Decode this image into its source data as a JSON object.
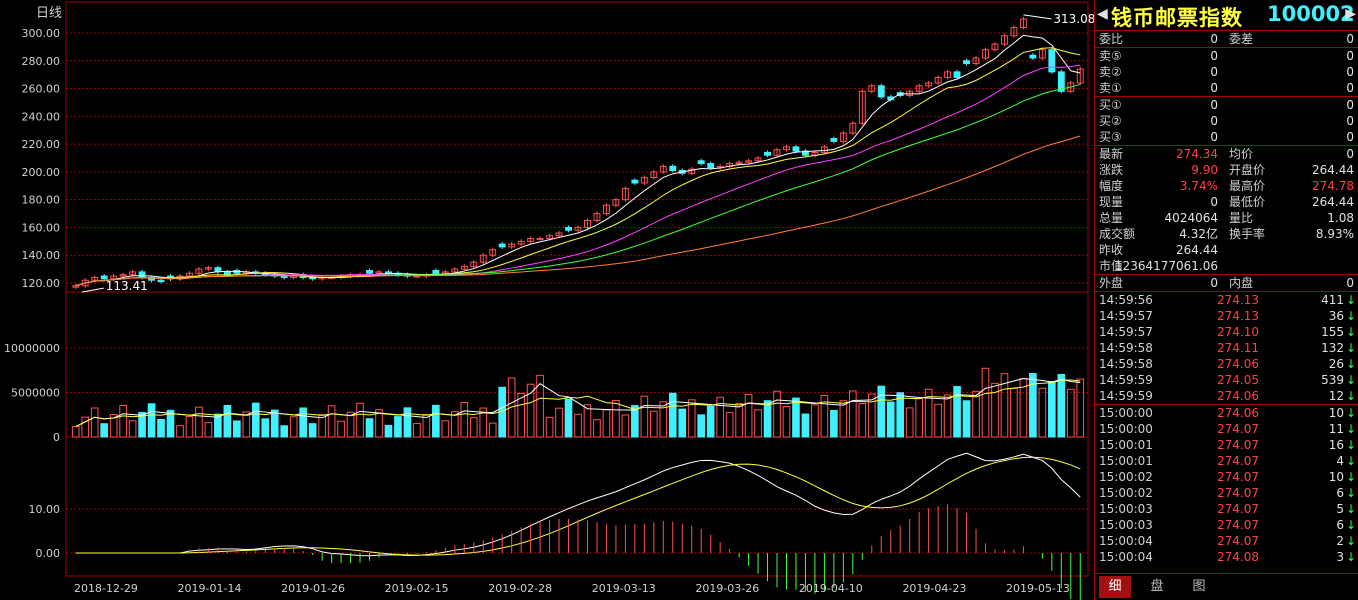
{
  "chart": {
    "period_label": "日线",
    "price_axis": [
      "300.00",
      "280.00",
      "260.00",
      "240.00",
      "220.00",
      "200.00",
      "180.00",
      "160.00",
      "140.00",
      "120.00"
    ],
    "volume_axis": [
      "10000000",
      "5000000",
      "0"
    ],
    "macd_axis": [
      "10.00",
      "0.00"
    ],
    "dates": [
      "2018-12-29",
      "2019-01-14",
      "2019-01-26",
      "2019-02-15",
      "2019-02-28",
      "2019-03-13",
      "2019-03-26",
      "2019-04-10",
      "2019-04-23",
      "2019-05-13"
    ],
    "high_marker": "313.08",
    "low_marker": "113.41",
    "colors": {
      "up": "#ff5050",
      "down": "#40f0ff",
      "grid": "#a00000",
      "ma5": "#ffffff",
      "ma10": "#ffff40",
      "ma20": "#ff40ff",
      "ma30": "#40ff40",
      "ma60": "#ff8030"
    }
  },
  "chart_data": {
    "type": "candlestick",
    "x": [
      "2018-12-29",
      "2019-01-14",
      "2019-01-26",
      "2019-02-15",
      "2019-02-28",
      "2019-03-13",
      "2019-03-26",
      "2019-04-10",
      "2019-04-23",
      "2019-05-13"
    ],
    "close_series": [
      118,
      122,
      124,
      123,
      125,
      126,
      128,
      124,
      122,
      121,
      123,
      125,
      127,
      130,
      131,
      128,
      126,
      127,
      128,
      127,
      126,
      125,
      124,
      125,
      124,
      123,
      124,
      124,
      125,
      126,
      126,
      127,
      128,
      127,
      126,
      125,
      125,
      126,
      127,
      128,
      130,
      132,
      135,
      140,
      144,
      146,
      148,
      150,
      152,
      152,
      154,
      156,
      158,
      160,
      165,
      170,
      176,
      180,
      188,
      192,
      196,
      200,
      204,
      201,
      199,
      202,
      206,
      203,
      204,
      206,
      207,
      208,
      210,
      212,
      216,
      218,
      215,
      212,
      214,
      218,
      222,
      228,
      235,
      258,
      262,
      254,
      252,
      255,
      258,
      262,
      264,
      268,
      272,
      268,
      278,
      282,
      288,
      292,
      298,
      304,
      310,
      282,
      288,
      272,
      258,
      264,
      274
    ],
    "high": 313.08,
    "low": 113.41,
    "ylim": [
      110,
      315
    ]
  },
  "quote": {
    "name": "钱币邮票指数",
    "code": "100002",
    "rows_top": [
      {
        "l": "委比",
        "v": "0",
        "l2": "委差",
        "v2": "0"
      }
    ],
    "asks": [
      {
        "l": "卖⑤",
        "v": "0",
        "v2": "0"
      },
      {
        "l": "卖②",
        "v": "0",
        "v2": "0"
      },
      {
        "l": "卖①",
        "v": "0",
        "v2": "0"
      }
    ],
    "bids": [
      {
        "l": "买①",
        "v": "0",
        "v2": "0"
      },
      {
        "l": "买②",
        "v": "0",
        "v2": "0"
      },
      {
        "l": "买③",
        "v": "0",
        "v2": "0"
      }
    ],
    "stats": [
      {
        "l": "最新",
        "v": "274.34",
        "vc": "r",
        "l2": "均价",
        "v2": "0",
        "v2c": "w"
      },
      {
        "l": "涨跌",
        "v": "9.90",
        "vc": "r",
        "l2": "开盘价",
        "v2": "264.44",
        "v2c": "w"
      },
      {
        "l": "幅度",
        "v": "3.74%",
        "vc": "r",
        "l2": "最高价",
        "v2": "274.78",
        "v2c": "r"
      },
      {
        "l": "现量",
        "v": "0",
        "vc": "w",
        "l2": "最低价",
        "v2": "264.44",
        "v2c": "w"
      },
      {
        "l": "总量",
        "v": "4024064",
        "vc": "w",
        "l2": "量比",
        "v2": "1.08",
        "v2c": "w"
      },
      {
        "l": "成交额",
        "v": "4.32亿",
        "vc": "w",
        "l2": "换手率",
        "v2": "8.93%",
        "v2c": "w"
      },
      {
        "l": "昨收",
        "v": "264.44",
        "vc": "w",
        "l2": "",
        "v2": "",
        "v2c": "w"
      },
      {
        "l": "市值",
        "v": "12364177061.06",
        "vc": "w",
        "l2": "",
        "v2": "",
        "v2c": "w"
      }
    ],
    "outer_inner": {
      "l": "外盘",
      "v": "0",
      "l2": "内盘",
      "v2": "0"
    },
    "ticks": [
      {
        "t": "14:59:56",
        "p": "274.13",
        "q": "411"
      },
      {
        "t": "14:59:57",
        "p": "274.13",
        "q": "36"
      },
      {
        "t": "14:59:57",
        "p": "274.10",
        "q": "155"
      },
      {
        "t": "14:59:58",
        "p": "274.11",
        "q": "132"
      },
      {
        "t": "14:59:58",
        "p": "274.06",
        "q": "26"
      },
      {
        "t": "14:59:59",
        "p": "274.05",
        "q": "539"
      },
      {
        "t": "14:59:59",
        "p": "274.06",
        "q": "12"
      },
      {
        "t": "15:00:00",
        "p": "274.06",
        "q": "10"
      },
      {
        "t": "15:00:00",
        "p": "274.07",
        "q": "11"
      },
      {
        "t": "15:00:01",
        "p": "274.07",
        "q": "16"
      },
      {
        "t": "15:00:01",
        "p": "274.07",
        "q": "4"
      },
      {
        "t": "15:00:02",
        "p": "274.07",
        "q": "10"
      },
      {
        "t": "15:00:02",
        "p": "274.07",
        "q": "6"
      },
      {
        "t": "15:00:03",
        "p": "274.07",
        "q": "5"
      },
      {
        "t": "15:00:03",
        "p": "274.07",
        "q": "6"
      },
      {
        "t": "15:00:04",
        "p": "274.07",
        "q": "2"
      },
      {
        "t": "15:00:04",
        "p": "274.08",
        "q": "3"
      }
    ],
    "arrow": "↓",
    "tabs": [
      "细",
      "盘",
      "图"
    ]
  }
}
